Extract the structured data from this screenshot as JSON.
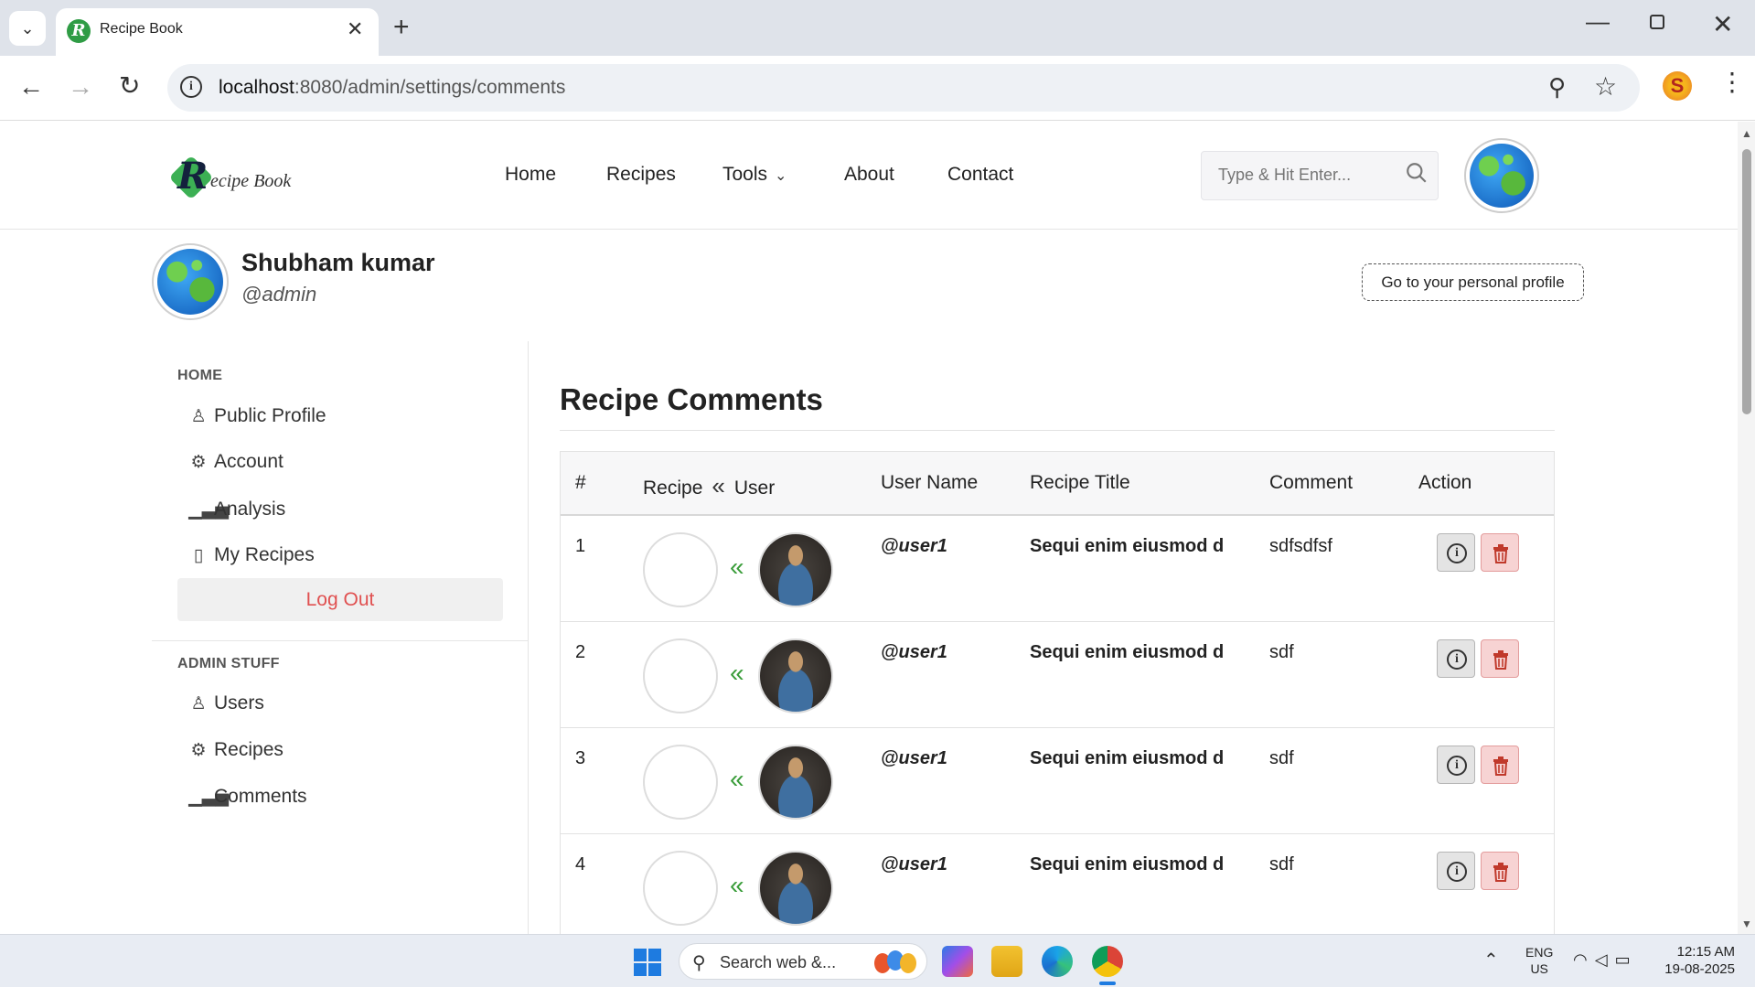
{
  "browser": {
    "tab_title": "Recipe Book",
    "url_host": "localhost",
    "url_path": ":8080/admin/settings/comments",
    "profile_initial": "S"
  },
  "site": {
    "logo_text": "ecipe Book",
    "logo_letter": "R",
    "nav": {
      "home": "Home",
      "recipes": "Recipes",
      "tools": "Tools",
      "about": "About",
      "contact": "Contact"
    },
    "search_placeholder": "Type & Hit Enter..."
  },
  "profile": {
    "name": "Shubham kumar",
    "handle": "@admin",
    "personal_profile_button": "Go to your personal profile"
  },
  "sidebar": {
    "home_section": "HOME",
    "home_items": [
      {
        "label": "Public Profile",
        "icon": "user-icon"
      },
      {
        "label": "Account",
        "icon": "gear-icon"
      },
      {
        "label": "Analysis",
        "icon": "bar-chart-icon"
      },
      {
        "label": "My Recipes",
        "icon": "bookmark-icon"
      }
    ],
    "logout": "Log Out",
    "admin_section": "ADMIN STUFF",
    "admin_items": [
      {
        "label": "Users",
        "icon": "user-icon"
      },
      {
        "label": "Recipes",
        "icon": "gear-icon"
      },
      {
        "label": "Comments",
        "icon": "bar-chart-icon"
      }
    ]
  },
  "main": {
    "title": "Recipe Comments",
    "columns": {
      "num": "#",
      "recipe": "Recipe",
      "user": "User",
      "user_name": "User Name",
      "recipe_title": "Recipe Title",
      "comment": "Comment",
      "action": "Action"
    },
    "rows": [
      {
        "num": "1",
        "user_name": "@user1",
        "recipe_title": "Sequi enim eiusmod d",
        "comment": "sdfsdfsf"
      },
      {
        "num": "2",
        "user_name": "@user1",
        "recipe_title": "Sequi enim eiusmod d",
        "comment": "sdf"
      },
      {
        "num": "3",
        "user_name": "@user1",
        "recipe_title": "Sequi enim eiusmod d",
        "comment": "sdf"
      },
      {
        "num": "4",
        "user_name": "@user1",
        "recipe_title": "Sequi enim eiusmod d",
        "comment": "sdf"
      }
    ]
  },
  "taskbar": {
    "search_text": "Search web &...",
    "lang_line1": "ENG",
    "lang_line2": "US",
    "time": "12:15 AM",
    "date": "19-08-2025"
  },
  "colors": {
    "accent_green": "#3cb054",
    "logout_red": "#e05050",
    "delete_bg": "#f7d3d3"
  }
}
